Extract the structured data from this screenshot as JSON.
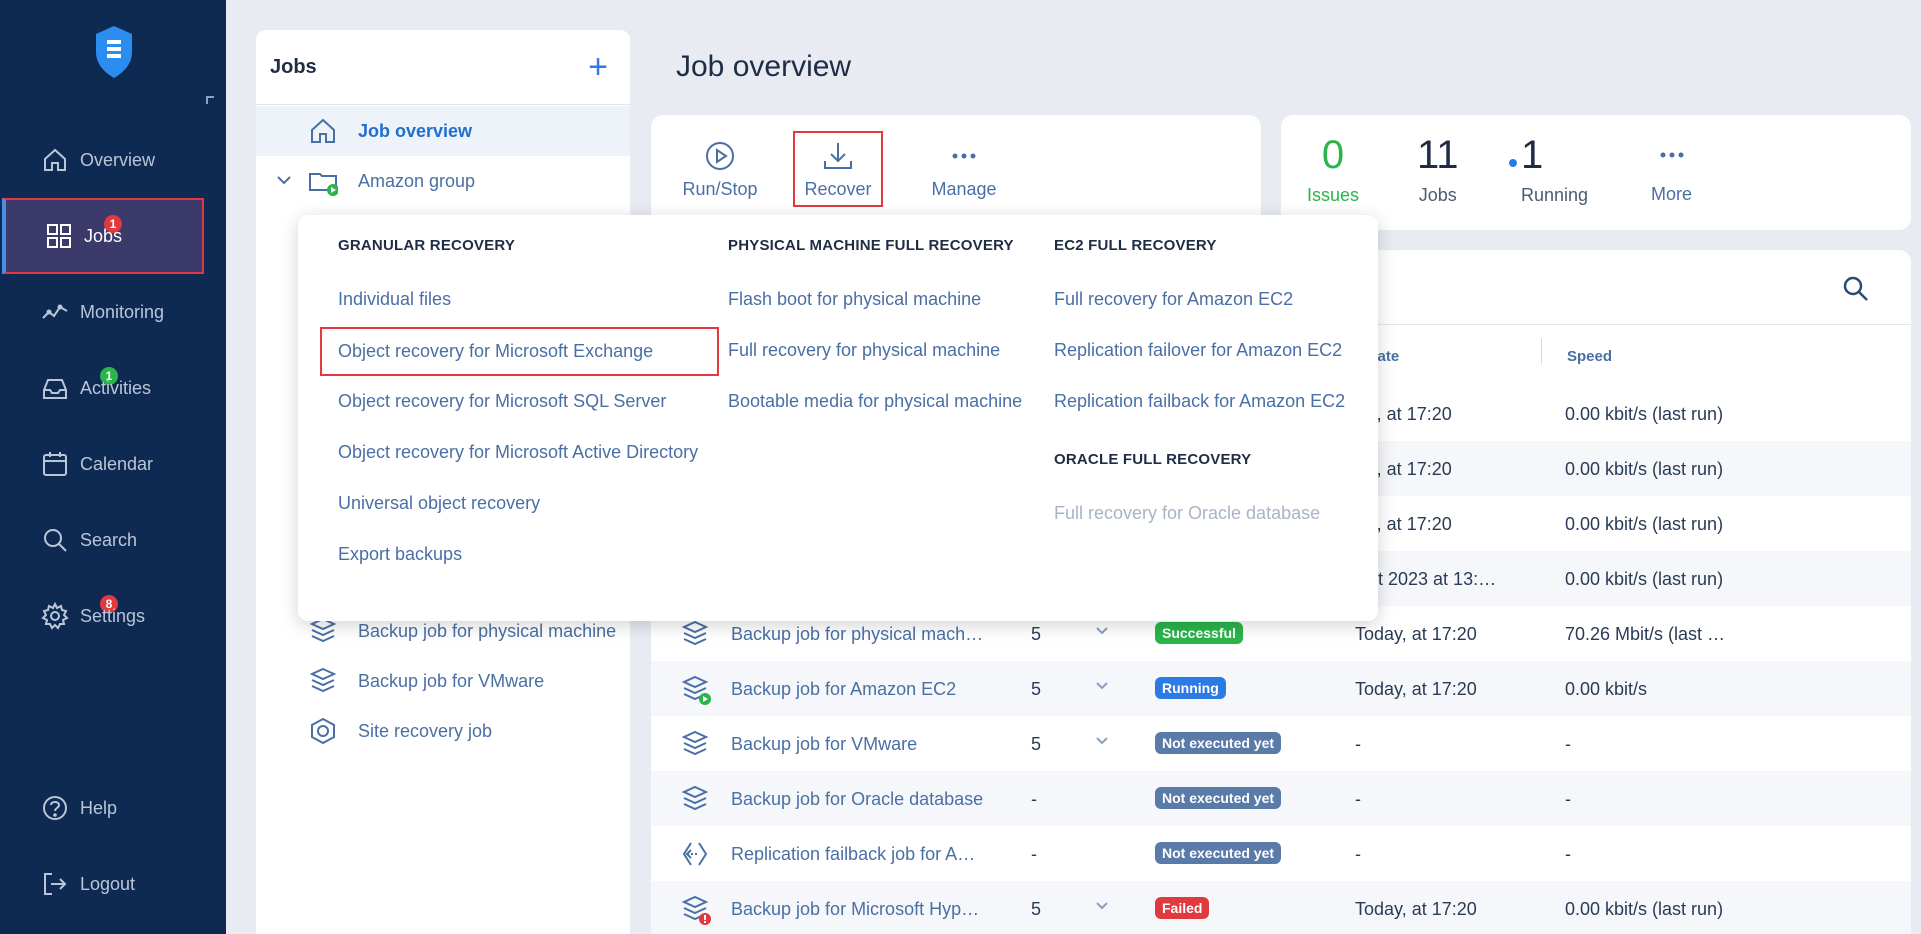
{
  "nav": {
    "items": [
      {
        "label": "Overview",
        "icon": "home-icon"
      },
      {
        "label": "Jobs",
        "icon": "grid-icon",
        "badge": "1"
      },
      {
        "label": "Monitoring",
        "icon": "monitoring-icon"
      },
      {
        "label": "Activities",
        "icon": "inbox-icon",
        "badge": "1"
      },
      {
        "label": "Calendar",
        "icon": "calendar-icon"
      },
      {
        "label": "Search",
        "icon": "search-icon"
      },
      {
        "label": "Settings",
        "icon": "gear-icon",
        "badge": "8"
      },
      {
        "label": "Help",
        "icon": "help-icon"
      },
      {
        "label": "Logout",
        "icon": "logout-icon"
      }
    ]
  },
  "jobs_panel": {
    "title": "Jobs",
    "add": "+",
    "tree": [
      {
        "label": "Job overview"
      },
      {
        "label": "Amazon group"
      },
      {
        "label": "Backup job for physical machine"
      },
      {
        "label": "Backup job for VMware"
      },
      {
        "label": "Site recovery job"
      }
    ]
  },
  "main": {
    "title": "Job overview",
    "toolbar": {
      "run_stop": "Run/Stop",
      "recover": "Recover",
      "manage": "Manage"
    },
    "stats": {
      "issues_num": "0",
      "issues_label": "Issues",
      "jobs_num": "11",
      "jobs_label": "Jobs",
      "running_num": "1",
      "running_label": "Running",
      "more_label": "More"
    }
  },
  "table": {
    "headers": {
      "date": "n date",
      "speed": "Speed"
    },
    "rows": [
      {
        "name": "",
        "count": "",
        "status": "",
        "date": "lay, at 17:20",
        "speed": "0.00 kbit/s (last run)"
      },
      {
        "name": "",
        "count": "",
        "status": "",
        "date": "lay, at 17:20",
        "speed": "0.00 kbit/s (last run)"
      },
      {
        "name": "",
        "count": "",
        "status": "",
        "date": "lay, at 17:20",
        "speed": "0.00 kbit/s (last run)"
      },
      {
        "name": "",
        "count": "",
        "status": "",
        "date": "Oct 2023 at 13:…",
        "speed": "0.00 kbit/s (last run)"
      },
      {
        "name": "Backup job for physical mach…",
        "count": "5",
        "status": "Successful",
        "date": "Today, at 17:20",
        "speed": "70.26 Mbit/s (last …"
      },
      {
        "name": "Backup job for Amazon EC2",
        "count": "5",
        "status": "Running",
        "date": "Today, at 17:20",
        "speed": "0.00 kbit/s"
      },
      {
        "name": "Backup job for VMware",
        "count": "5",
        "status": "Not executed yet",
        "date": "-",
        "speed": "-"
      },
      {
        "name": "Backup job for Oracle database",
        "count": "-",
        "status": "Not executed yet",
        "date": "-",
        "speed": "-"
      },
      {
        "name": "Replication failback job for A…",
        "count": "-",
        "status": "Not executed yet",
        "date": "-",
        "speed": "-"
      },
      {
        "name": "Backup job for Microsoft Hyp…",
        "count": "5",
        "status": "Failed",
        "date": "Today, at 17:20",
        "speed": "0.00 kbit/s (last run)"
      }
    ]
  },
  "dropdown": {
    "granular_head": "GRANULAR RECOVERY",
    "granular": [
      "Individual files",
      "Object recovery for Microsoft Exchange",
      "Object recovery for Microsoft SQL Server",
      "Object recovery for Microsoft Active Directory",
      "Universal object recovery",
      "Export backups"
    ],
    "physical_head": "PHYSICAL MACHINE FULL RECOVERY",
    "physical": [
      "Flash boot for physical machine",
      "Full recovery for physical machine",
      "Bootable media for physical machine"
    ],
    "ec2_head": "EC2 FULL RECOVERY",
    "ec2": [
      "Full recovery for Amazon EC2",
      "Replication failover for Amazon EC2",
      "Replication failback for Amazon EC2"
    ],
    "oracle_head": "ORACLE FULL RECOVERY",
    "oracle": [
      "Full recovery for Oracle database"
    ]
  },
  "colors": {
    "nav_bg": "#0f2a52",
    "accent": "#2c7be5",
    "success": "#2ab54b",
    "danger": "#e0393e"
  }
}
